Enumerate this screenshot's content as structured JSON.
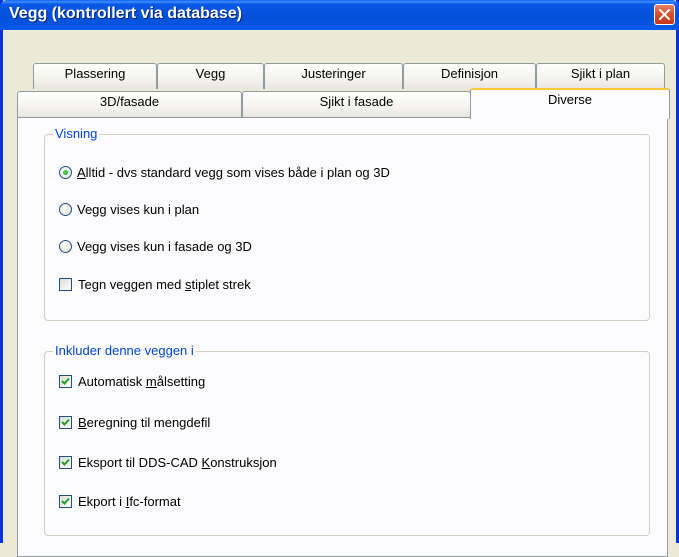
{
  "window": {
    "title": "Vegg (kontrollert via database)"
  },
  "tabs_back_row": [
    {
      "label": "Plassering"
    },
    {
      "label": "Vegg"
    },
    {
      "label": "Justeringer"
    },
    {
      "label": "Definisjon"
    },
    {
      "label": "Sjikt i plan"
    }
  ],
  "tabs_front_row": [
    {
      "label": "3D/fasade"
    },
    {
      "label": "Sjikt i fasade"
    },
    {
      "label": "Diverse",
      "active": true
    }
  ],
  "visning": {
    "legend": "Visning",
    "options": [
      {
        "hotkey": "A",
        "rest": "lltid - dvs standard vegg som vises både i plan og 3D",
        "checked": true
      },
      {
        "text": "Vegg vises kun i plan",
        "checked": false
      },
      {
        "text": "Vegg vises kun i fasade og 3D",
        "checked": false
      }
    ],
    "stiplet": {
      "before": "Tegn veggen med ",
      "hotkey": "s",
      "after": "tiplet strek",
      "checked": false
    }
  },
  "inkluder": {
    "legend": "Inkluder denne veggen i",
    "items": [
      {
        "before": "Automatisk ",
        "hotkey": "m",
        "after": "ålsetting",
        "checked": true
      },
      {
        "before": "",
        "hotkey": "B",
        "after": "eregning til mengdefil",
        "checked": true
      },
      {
        "before": "Eksport til DDS-CAD ",
        "hotkey": "K",
        "after": "onstruksjon",
        "checked": true
      },
      {
        "before": "Ekport i ",
        "hotkey": "I",
        "after": "fc-format",
        "checked": true
      }
    ]
  },
  "colors": {
    "titlebar": "#0054e3",
    "dialog_face": "#ece9d8",
    "groupbox_legend": "#0046d5",
    "active_tab_highlight": "#ffc83c",
    "radio_dot": "#21a121",
    "check_mark": "#21a121"
  }
}
